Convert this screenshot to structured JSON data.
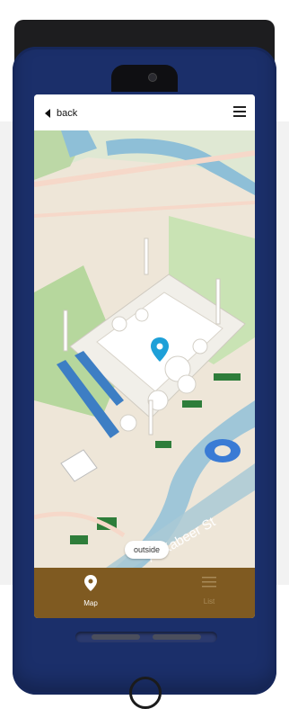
{
  "header": {
    "back_label": "back",
    "menu_icon": "hamburger-icon"
  },
  "map": {
    "road_label": "Al Kabeer St",
    "toggle_label": "outside",
    "marker_icon": "location-pin-icon"
  },
  "bottom_nav": {
    "tabs": [
      {
        "label": "Map",
        "icon": "map-pin-icon",
        "active": true
      },
      {
        "label": "List",
        "icon": "list-icon",
        "active": false
      }
    ]
  },
  "colors": {
    "device_body": "#1b2f6a",
    "nav_bar": "#7f5a21",
    "map_ground": "#e9e2d6",
    "water": "#7fb4cf",
    "marker": "#1ea0d8"
  }
}
